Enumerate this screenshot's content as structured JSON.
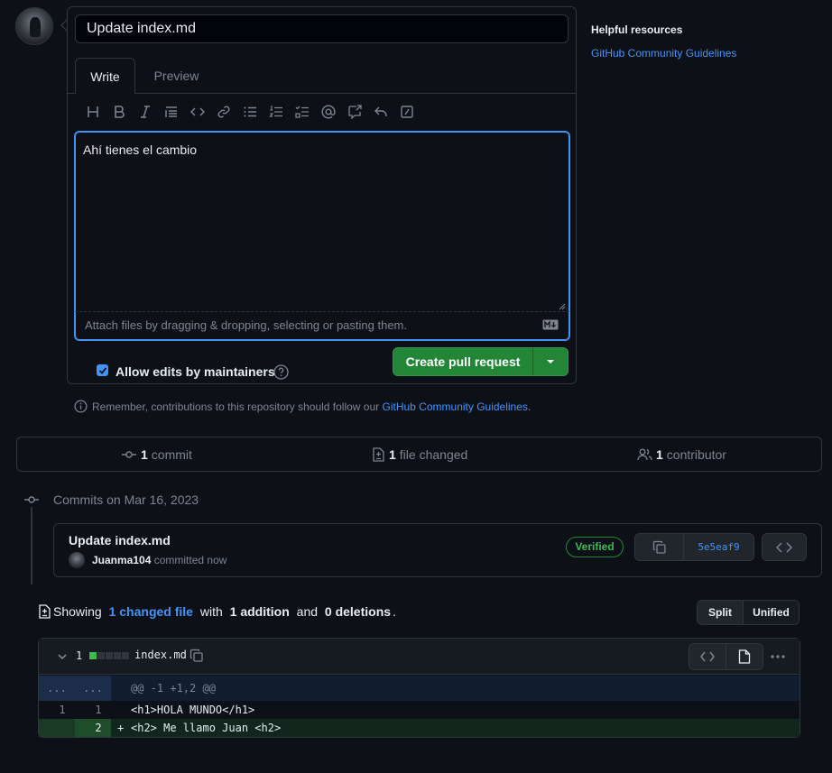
{
  "compose": {
    "title_value": "Update index.md",
    "tabs": [
      {
        "label": "Write"
      },
      {
        "label": "Preview"
      }
    ],
    "toolbar_icons": [
      "heading-icon",
      "bold-icon",
      "italic-icon",
      "quote-icon",
      "code-icon",
      "link-icon",
      "unordered-list-icon",
      "ordered-list-icon",
      "task-list-icon",
      "mention-icon",
      "reference-icon",
      "reply-icon",
      "slash-command-icon"
    ],
    "body_value": "Ahí tienes el cambio",
    "attach_hint": "Attach files by dragging & dropping, selecting or pasting them.",
    "allow_edits_label": "Allow edits by maintainers",
    "allow_edits_checked": true,
    "create_button": "Create pull request",
    "remember_prefix": "Remember, contributions to this repository should follow our",
    "remember_link": "GitHub Community Guidelines",
    "remember_suffix": "."
  },
  "sidebar": {
    "title": "Helpful resources",
    "link": "GitHub Community Guidelines"
  },
  "summary": {
    "commits_count": "1",
    "commits_label": "commit",
    "files_count": "1",
    "files_label": "file changed",
    "contributors_count": "1",
    "contributors_label": "contributor"
  },
  "commits": {
    "date_heading": "Commits on Mar 16, 2023",
    "item": {
      "title": "Update index.md",
      "author": "Juanma104",
      "time": "committed now",
      "verified": "Verified",
      "sha": "5e5eaf9"
    }
  },
  "diff": {
    "showing": "Showing",
    "changed_files": "1 changed file",
    "with": "with",
    "additions": "1 addition",
    "and": "and",
    "deletions": "0 deletions",
    "period": ".",
    "view_split": "Split",
    "view_unified": "Unified",
    "file": {
      "count": "1",
      "name": "index.md",
      "hunk_left": "...",
      "hunk_right": "...",
      "hunk": "@@ -1 +1,2 @@",
      "lines": [
        {
          "old": "1",
          "new": "1",
          "sign": "",
          "text": "<h1>HOLA MUNDO</h1>",
          "type": "context"
        },
        {
          "old": "",
          "new": "2",
          "sign": "+",
          "text": "<h2> Me llamo Juan <h2>",
          "type": "add"
        }
      ]
    }
  },
  "colors": {
    "background": "#0d1117",
    "border": "#30363d",
    "accent": "#4493f8",
    "success": "#238636",
    "addition": "#3fb950"
  }
}
